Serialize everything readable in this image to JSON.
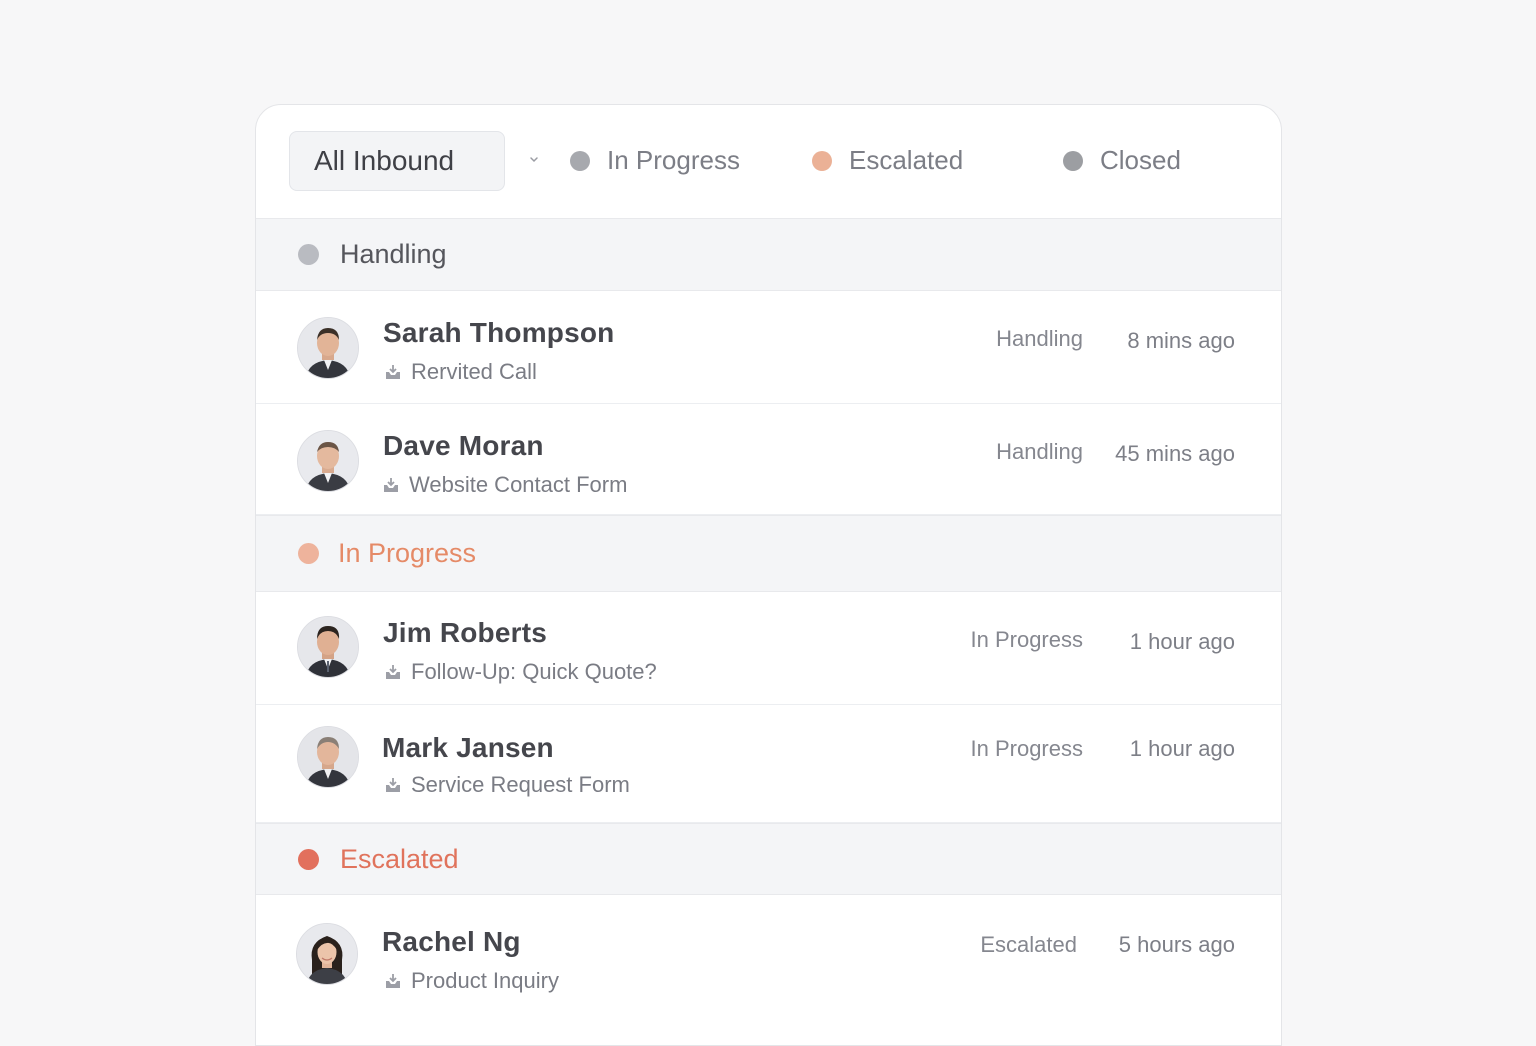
{
  "filters": {
    "view_select": "All Inbound",
    "items": [
      {
        "label": "In Progress",
        "color": "#a7a9ae"
      },
      {
        "label": "Escalated",
        "color": "#ebb196"
      },
      {
        "label": "Closed",
        "color": "#9c9ea2"
      }
    ]
  },
  "sections": [
    {
      "label": "Handling",
      "dot_color": "#b9bbc1",
      "label_color": "#55565c"
    },
    {
      "label": "In Progress",
      "dot_color": "#eeb39c",
      "label_color": "#e58a67"
    },
    {
      "label": "Escalated",
      "dot_color": "#e2705d",
      "label_color": "#e0735c"
    }
  ],
  "rows": [
    {
      "name": "Sarah Thompson",
      "source": "Rervited Call",
      "status": "Handling",
      "time": "8 mins ago",
      "avatar": "man-avatar"
    },
    {
      "name": "Dave Moran",
      "source": "Website Contact Form",
      "status": "Handling",
      "time": "45 mins ago",
      "avatar": "man-avatar"
    },
    {
      "name": "Jim Roberts",
      "source": "Follow-Up: Quick Quote?",
      "status": "In Progress",
      "time": "1 hour ago",
      "avatar": "man-avatar"
    },
    {
      "name": "Mark Jansen",
      "source": "Service Request Form",
      "status": "In Progress",
      "time": "1 hour ago",
      "avatar": "man-avatar"
    },
    {
      "name": "Rachel Ng",
      "source": "Product Inquiry",
      "status": "Escalated",
      "time": "5 hours ago",
      "avatar": "woman-avatar"
    }
  ],
  "icons": {
    "dropdown": "chevron-down-icon",
    "source": "inbox-tray-icon"
  }
}
